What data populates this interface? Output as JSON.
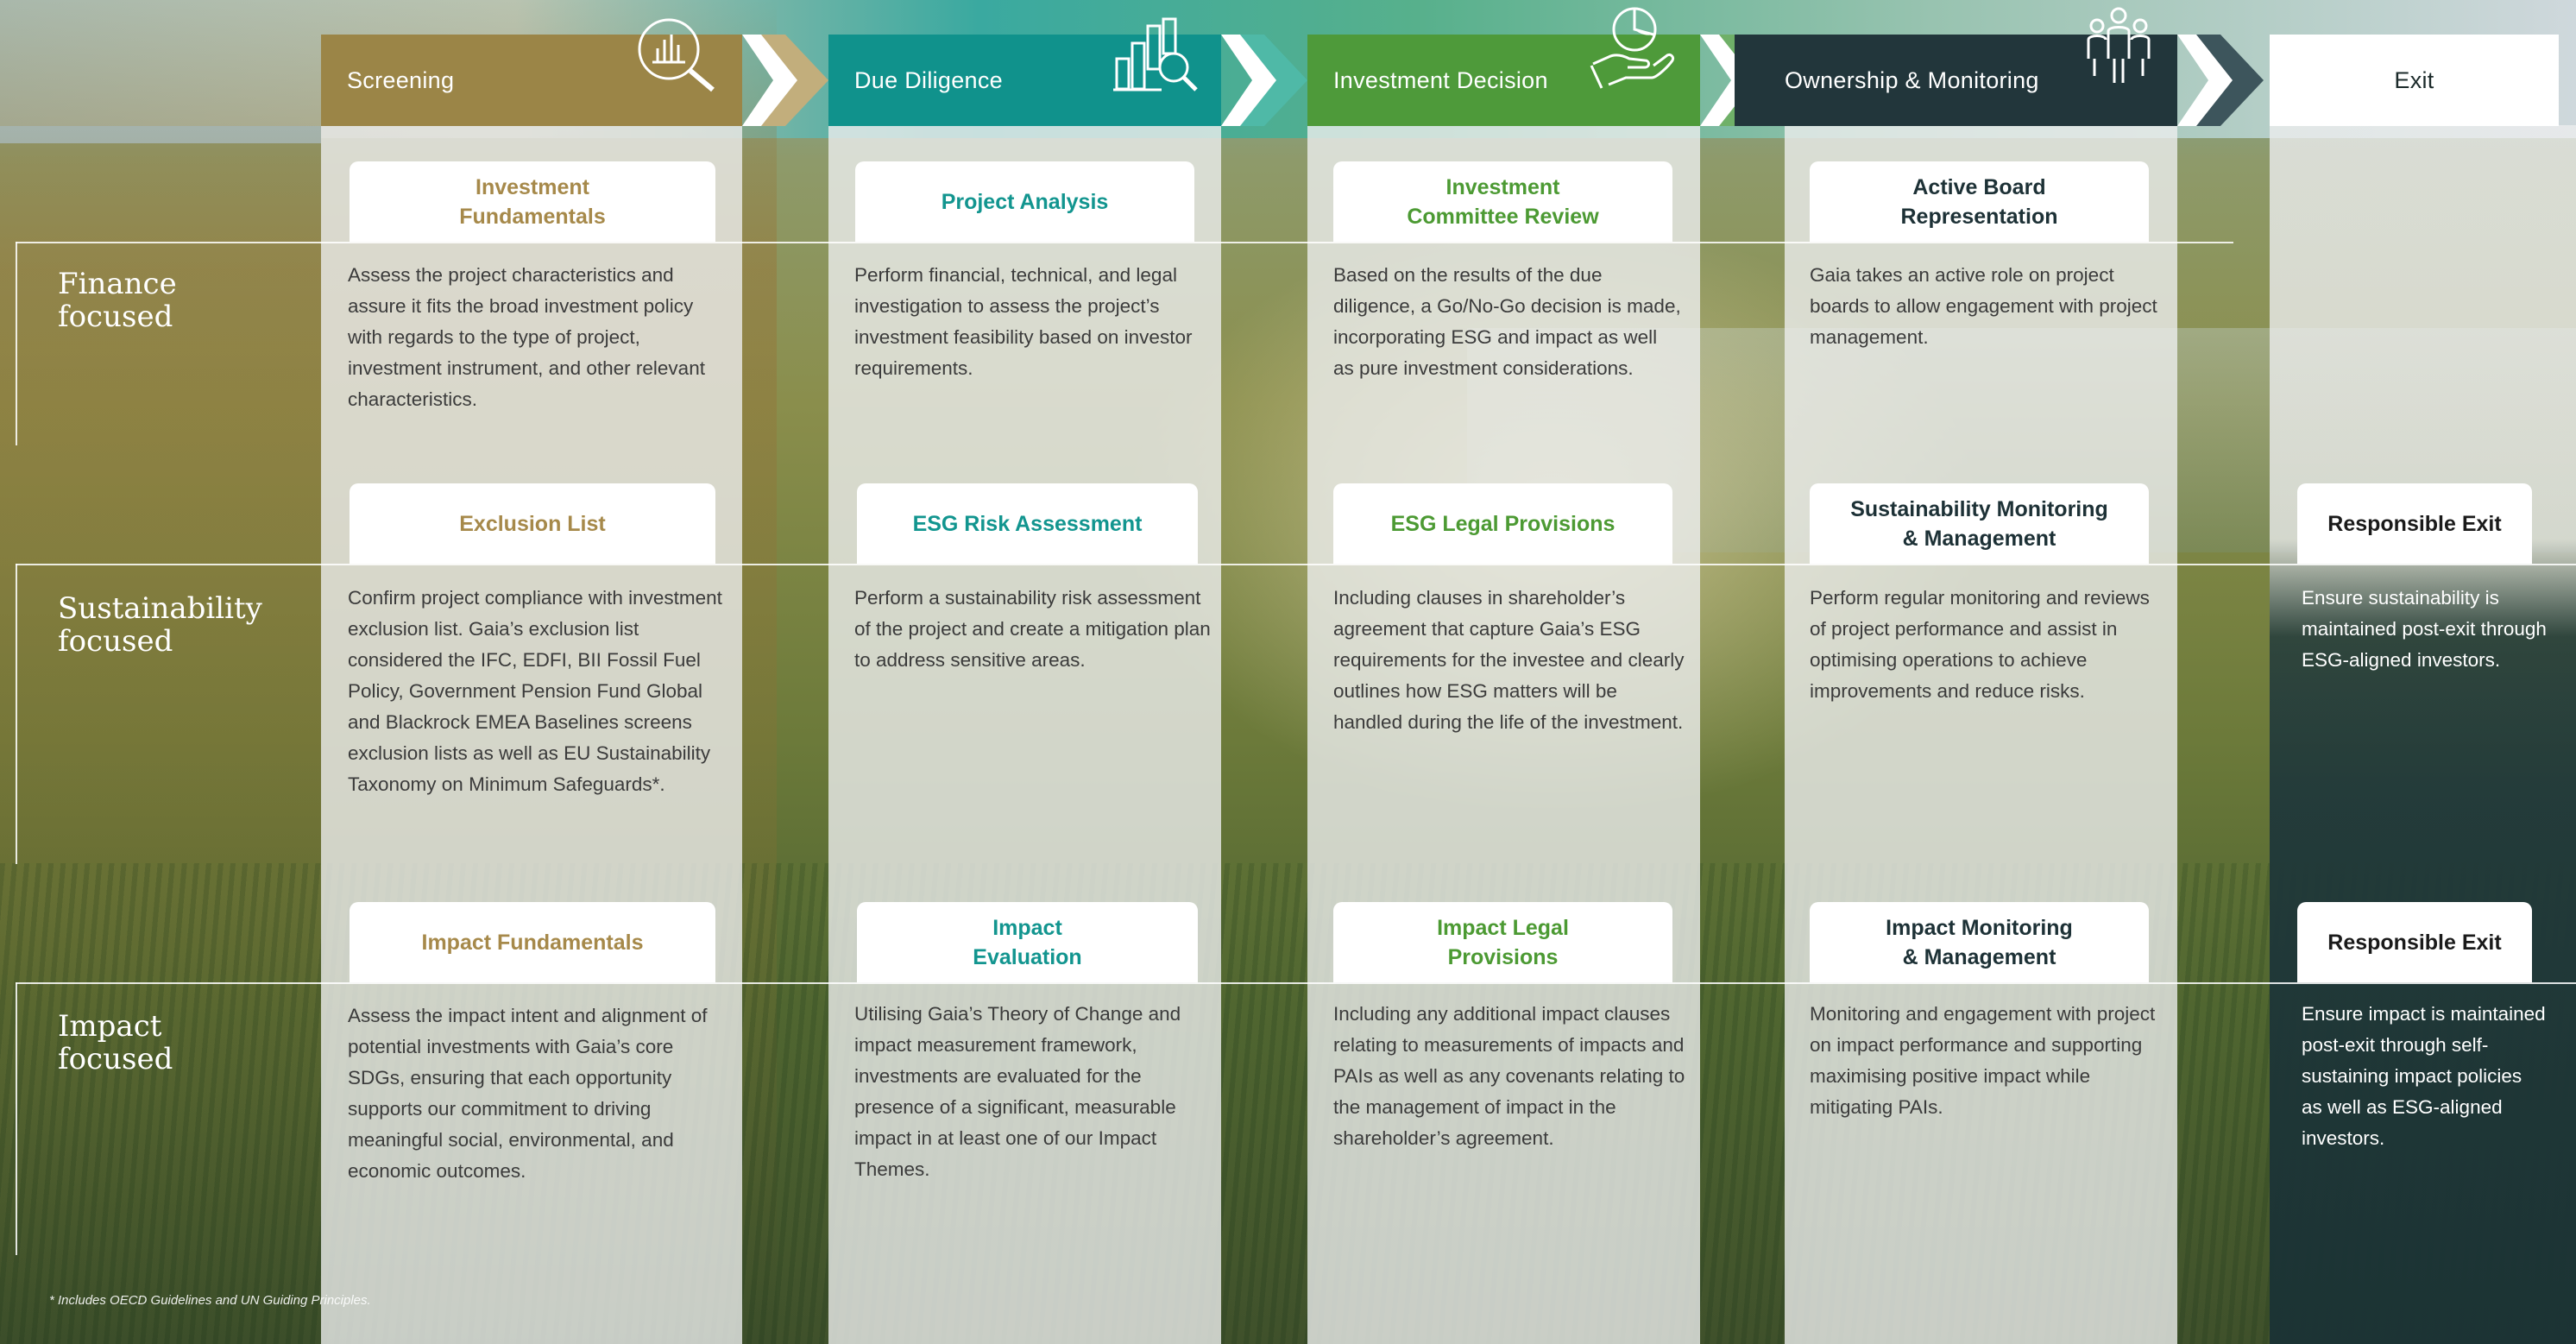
{
  "stages": [
    {
      "label": "Screening"
    },
    {
      "label": "Due Diligence"
    },
    {
      "label": "Investment Decision"
    },
    {
      "label": "Ownership & Monitoring"
    },
    {
      "label": "Exit"
    }
  ],
  "rows": {
    "finance": "Finance\nfocused",
    "sustainability": "Sustainability\nfocused",
    "impact": "Impact\nfocused"
  },
  "cards": {
    "finance": [
      {
        "title": "Investment\nFundamentals",
        "text": "Assess the project characteristics and assure it fits the broad investment policy with regards to the type of project, investment instrument, and other relevant characteristics."
      },
      {
        "title": "Project Analysis",
        "text": "Perform financial, technical, and legal investigation to assess the project’s investment feasibility based on investor requirements."
      },
      {
        "title": "Investment\nCommittee Review",
        "text": "Based on the results of the due diligence, a Go/No-Go decision is made, incorporating ESG and impact as well as pure investment considerations."
      },
      {
        "title": "Active Board\nRepresentation",
        "text": "Gaia takes an active role on project boards to allow engagement with project management."
      }
    ],
    "sustainability": [
      {
        "title": "Exclusion List",
        "text": "Confirm project compliance with investment exclusion list. Gaia’s exclusion list considered the IFC, EDFI, BII Fossil Fuel Policy, Government Pension Fund Global and Blackrock EMEA Baselines screens exclusion lists as well as EU Sustainability Taxonomy on Minimum Safeguards*."
      },
      {
        "title": "ESG Risk Assessment",
        "text": "Perform a sustainability risk assessment of the project and create a mitigation plan to address sensitive areas."
      },
      {
        "title": "ESG Legal Provisions",
        "text": "Including clauses in shareholder’s agreement that capture Gaia’s ESG requirements for the investee and clearly outlines how ESG matters will be handled during the life of the investment."
      },
      {
        "title": "Sustainability Monitoring\n& Management",
        "text": "Perform regular monitoring and reviews of project performance and assist in optimising operations to achieve improvements and reduce risks."
      },
      {
        "title": "Responsible Exit",
        "text": "Ensure sustainability is maintained post-exit through ESG-aligned investors."
      }
    ],
    "impact": [
      {
        "title": "Impact Fundamentals",
        "text": "Assess the impact intent and alignment of potential investments with Gaia’s core SDGs, ensuring that each opportunity supports our commitment to driving meaningful social, environmental, and economic outcomes."
      },
      {
        "title": "Impact\nEvaluation",
        "text": "Utilising Gaia’s Theory of Change and impact measurement framework, investments are evaluated for the presence of a significant, measurable impact in at least one of our Impact Themes."
      },
      {
        "title": "Impact Legal\nProvisions",
        "text": "Including any additional impact clauses relating to measurements of impacts and PAIs as well as any covenants relating to the management of impact in the shareholder’s agreement."
      },
      {
        "title": "Impact Monitoring\n& Management",
        "text": "Monitoring and engagement with project on impact performance and supporting maximising positive impact while mitigating PAIs."
      },
      {
        "title": "Responsible Exit",
        "text": "Ensure impact is maintained post-exit through self-sustaining impact policies as well as ESG-aligned investors."
      }
    ]
  },
  "footnote": "* Includes OECD Guidelines and UN Guiding Principles.",
  "colors": {
    "screening": "#9b8547",
    "due_diligence": "#10928c",
    "investment_decision": "#4e9a3a",
    "ownership": "#22363b",
    "exit": "#ffffff"
  },
  "icons": [
    "magnifier-chart-icon",
    "bar-chart-magnifier-icon",
    "hand-pie-chart-icon",
    "people-group-icon"
  ]
}
